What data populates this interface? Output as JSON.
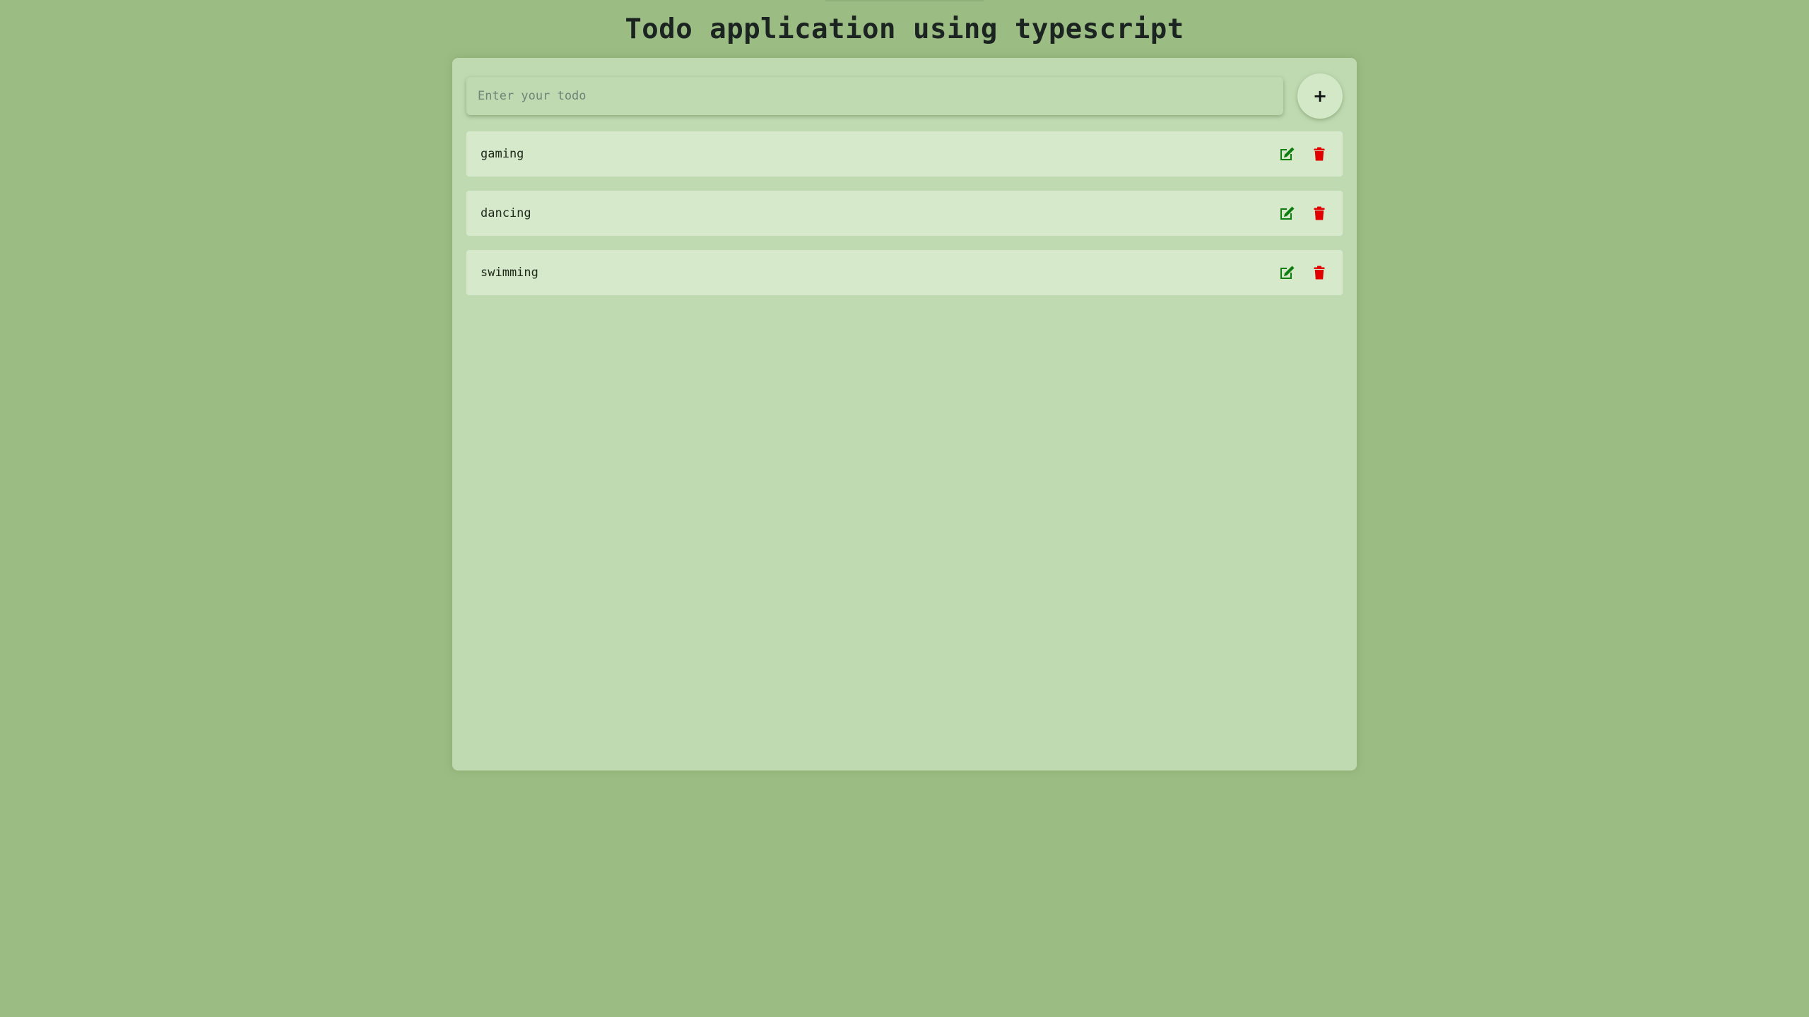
{
  "header": {
    "title": "Todo application using typescript"
  },
  "input": {
    "placeholder": "Enter your todo",
    "value": ""
  },
  "add_button": {
    "label": "+",
    "icon": "plus-icon"
  },
  "todos": [
    {
      "text": "gaming"
    },
    {
      "text": "dancing"
    },
    {
      "text": "swimming"
    }
  ],
  "icons": {
    "edit": "edit-icon",
    "delete": "trash-icon"
  },
  "colors": {
    "background": "#9bbc83",
    "panel": "#bfd9b1",
    "item": "#d6e9cb",
    "edit_icon": "#0f7d10",
    "delete_icon": "#e00000"
  }
}
